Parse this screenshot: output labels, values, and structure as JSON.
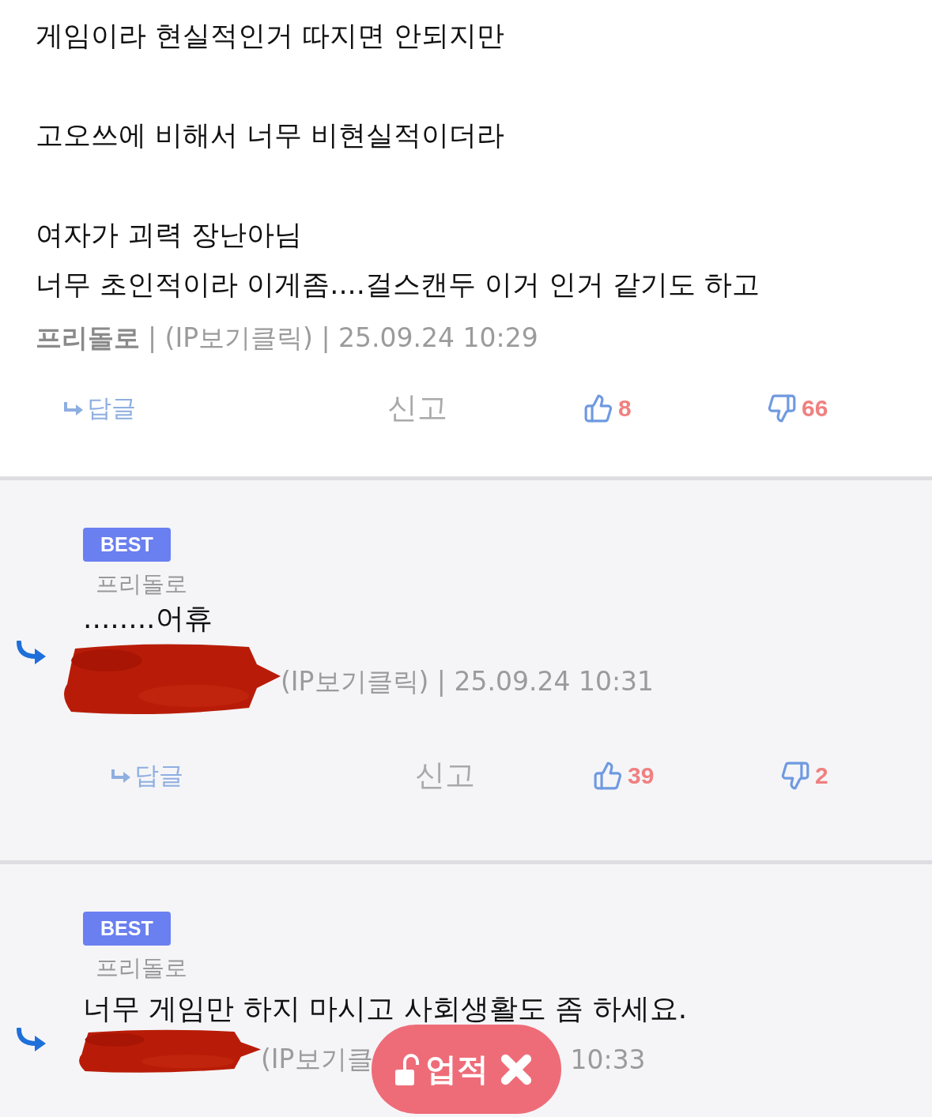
{
  "comments": [
    {
      "best": false,
      "reply": false,
      "paragraphs": [
        [
          "게임이라 현실적인거 따지면 안되지만"
        ],
        [
          "고오쓰에 비해서 너무 비현실적이더라"
        ],
        [
          "여자가 괴력 장난아님",
          "너무 초인적이라 이게좀....걸스캔두 이거 인거 같기도 하고"
        ]
      ],
      "author": "프리돌로",
      "meta": [
        "| (IP보기클릭) | 25.09.24 10:29"
      ],
      "actions": {
        "reply": "답글",
        "report": "신고",
        "likes": "8",
        "dislikes": "66"
      }
    },
    {
      "best": true,
      "badge": "BEST",
      "reply": true,
      "nickname": "프리돌로",
      "paragraphs": [
        [
          "........어휴"
        ]
      ],
      "author_redacted": true,
      "meta": [
        "(IP보기클릭) | 25.09.24 10:31"
      ],
      "actions": {
        "reply": "답글",
        "report": "신고",
        "likes": "39",
        "dislikes": "2"
      }
    },
    {
      "best": true,
      "badge": "BEST",
      "reply": true,
      "nickname": "프리돌로",
      "paragraphs": [
        [
          "너무 게임만 하지 마시고 사회생활도 좀 하세요."
        ]
      ],
      "author_redacted": true,
      "meta": [
        "(IP보기클",
        "10:33"
      ]
    }
  ],
  "floating_button": {
    "label": "업적"
  }
}
